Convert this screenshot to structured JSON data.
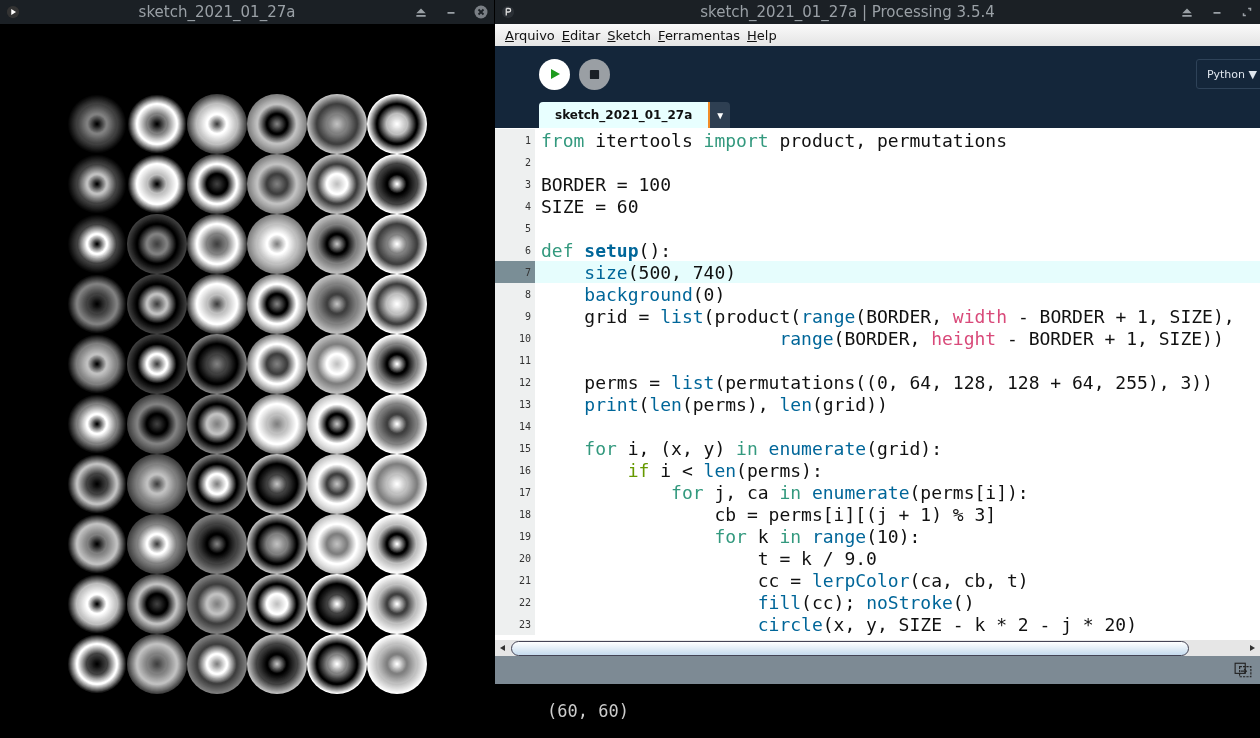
{
  "sketch_window": {
    "title": "sketch_2021_01_27a"
  },
  "ide_window": {
    "title": "sketch_2021_01_27a | Processing 3.5.4"
  },
  "menu": [
    "Arquivo",
    "Editar",
    "Sketch",
    "Ferramentas",
    "Help"
  ],
  "mode": {
    "label": "Python",
    "caret": "▼"
  },
  "tabs": [
    {
      "label": "sketch_2021_01_27a",
      "selected": true,
      "caret": "▼"
    }
  ],
  "code_lines": [
    {
      "number": "1",
      "current": false,
      "tokens": [
        {
          "kind": "keyword",
          "text": "from"
        },
        {
          "kind": "plain",
          "text": " itertools "
        },
        {
          "kind": "keyword",
          "text": "import"
        },
        {
          "kind": "plain",
          "text": " product, permutations"
        }
      ]
    },
    {
      "number": "2",
      "current": false
    },
    {
      "number": "3",
      "current": false,
      "tokens": [
        {
          "kind": "plain",
          "text": "BORDER = 100"
        }
      ]
    },
    {
      "number": "4",
      "current": false,
      "tokens": [
        {
          "kind": "plain",
          "text": "SIZE = 60"
        }
      ]
    },
    {
      "number": "5",
      "current": false
    },
    {
      "number": "6",
      "current": false,
      "tokens": [
        {
          "kind": "keyword",
          "text": "def "
        },
        {
          "kind": "defname",
          "text": "setup"
        },
        {
          "kind": "plain",
          "text": "():"
        }
      ]
    },
    {
      "number": "7",
      "current": true,
      "tokens": [
        {
          "kind": "function",
          "text": "    size"
        },
        {
          "kind": "plain",
          "text": "(500, 740)"
        }
      ]
    },
    {
      "number": "8",
      "current": false,
      "tokens": [
        {
          "kind": "function",
          "text": "    background"
        },
        {
          "kind": "plain",
          "text": "(0)"
        }
      ]
    },
    {
      "number": "9",
      "current": false,
      "tokens": [
        {
          "kind": "plain",
          "text": "    grid = "
        },
        {
          "kind": "function",
          "text": "list"
        },
        {
          "kind": "plain",
          "text": "(product("
        },
        {
          "kind": "function",
          "text": "range"
        },
        {
          "kind": "plain",
          "text": "(BORDER, "
        },
        {
          "kind": "variable",
          "text": "width"
        },
        {
          "kind": "plain",
          "text": " - BORDER + 1, SIZE),"
        }
      ]
    },
    {
      "number": "10",
      "current": false,
      "tokens": [
        {
          "kind": "function",
          "text": "                      range"
        },
        {
          "kind": "plain",
          "text": "(BORDER, "
        },
        {
          "kind": "variable",
          "text": "height"
        },
        {
          "kind": "plain",
          "text": " - BORDER + 1, SIZE))"
        }
      ]
    },
    {
      "number": "11",
      "current": false
    },
    {
      "number": "12",
      "current": false,
      "tokens": [
        {
          "kind": "plain",
          "text": "    perms = "
        },
        {
          "kind": "function",
          "text": "list"
        },
        {
          "kind": "plain",
          "text": "(permutations((0, 64, 128, 128 + 64, 255), 3))"
        }
      ]
    },
    {
      "number": "13",
      "current": false,
      "tokens": [
        {
          "kind": "function",
          "text": "    print"
        },
        {
          "kind": "plain",
          "text": "("
        },
        {
          "kind": "function",
          "text": "len"
        },
        {
          "kind": "plain",
          "text": "(perms), "
        },
        {
          "kind": "function",
          "text": "len"
        },
        {
          "kind": "plain",
          "text": "(grid))"
        }
      ]
    },
    {
      "number": "14",
      "current": false
    },
    {
      "number": "15",
      "current": false,
      "tokens": [
        {
          "kind": "keyword",
          "text": "    for"
        },
        {
          "kind": "plain",
          "text": " i, (x, y) "
        },
        {
          "kind": "keyword",
          "text": "in "
        },
        {
          "kind": "function",
          "text": "enumerate"
        },
        {
          "kind": "plain",
          "text": "(grid):"
        }
      ]
    },
    {
      "number": "16",
      "current": false,
      "tokens": [
        {
          "kind": "control",
          "text": "        if"
        },
        {
          "kind": "plain",
          "text": " i < "
        },
        {
          "kind": "function",
          "text": "len"
        },
        {
          "kind": "plain",
          "text": "(perms):"
        }
      ]
    },
    {
      "number": "17",
      "current": false,
      "tokens": [
        {
          "kind": "keyword",
          "text": "            for"
        },
        {
          "kind": "plain",
          "text": " j, ca "
        },
        {
          "kind": "keyword",
          "text": "in "
        },
        {
          "kind": "function",
          "text": "enumerate"
        },
        {
          "kind": "plain",
          "text": "(perms[i]):"
        }
      ]
    },
    {
      "number": "18",
      "current": false,
      "tokens": [
        {
          "kind": "plain",
          "text": "                cb = perms[i][(j + 1) % 3]"
        }
      ]
    },
    {
      "number": "19",
      "current": false,
      "tokens": [
        {
          "kind": "keyword",
          "text": "                for"
        },
        {
          "kind": "plain",
          "text": " k "
        },
        {
          "kind": "keyword",
          "text": "in "
        },
        {
          "kind": "function",
          "text": "range"
        },
        {
          "kind": "plain",
          "text": "(10):"
        }
      ]
    },
    {
      "number": "20",
      "current": false,
      "tokens": [
        {
          "kind": "plain",
          "text": "                    t = k / 9.0"
        }
      ]
    },
    {
      "number": "21",
      "current": false,
      "tokens": [
        {
          "kind": "plain",
          "text": "                    cc = "
        },
        {
          "kind": "function",
          "text": "lerpColor"
        },
        {
          "kind": "plain",
          "text": "(ca, cb, t)"
        }
      ]
    },
    {
      "number": "22",
      "current": false,
      "tokens": [
        {
          "kind": "function",
          "text": "                    fill"
        },
        {
          "kind": "plain",
          "text": "(cc); "
        },
        {
          "kind": "function",
          "text": "noStroke"
        },
        {
          "kind": "plain",
          "text": "()"
        }
      ]
    },
    {
      "number": "23",
      "current": false,
      "tokens": [
        {
          "kind": "function",
          "text": "                    circle"
        },
        {
          "kind": "plain",
          "text": "(x, y, SIZE - k * 2 - j * 20)"
        }
      ]
    }
  ],
  "console": {
    "output": "(60, 60)"
  }
}
